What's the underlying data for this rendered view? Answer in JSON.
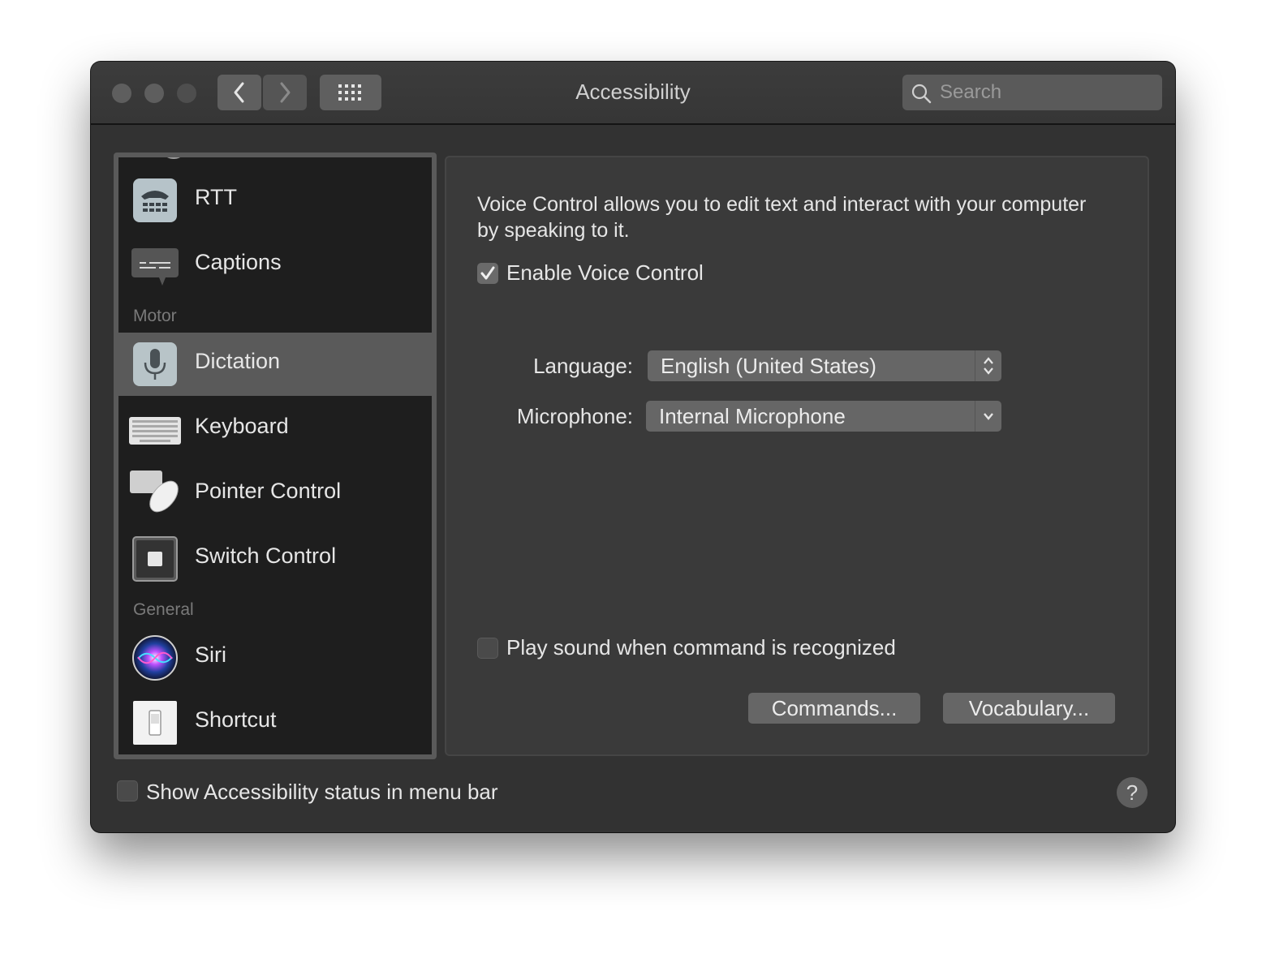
{
  "window": {
    "title": "Accessibility"
  },
  "toolbar": {
    "back_icon": "chevron-left-icon",
    "forward_icon": "chevron-right-icon",
    "grid_icon": "grid-icon",
    "search_placeholder": "Search"
  },
  "sidebar": {
    "sections": {
      "motor": "Motor",
      "general": "General"
    },
    "items": [
      {
        "label": "RTT",
        "icon": "rtt-icon"
      },
      {
        "label": "Captions",
        "icon": "captions-icon"
      },
      {
        "label": "Dictation",
        "icon": "microphone-icon",
        "selected": true
      },
      {
        "label": "Keyboard",
        "icon": "keyboard-icon"
      },
      {
        "label": "Pointer Control",
        "icon": "pointer-control-icon"
      },
      {
        "label": "Switch Control",
        "icon": "switch-control-icon"
      },
      {
        "label": "Siri",
        "icon": "siri-icon"
      },
      {
        "label": "Shortcut",
        "icon": "shortcut-icon"
      }
    ]
  },
  "panel": {
    "description": "Voice Control allows you to edit text and interact with your computer by speaking to it.",
    "enable_voice_control": {
      "label": "Enable Voice Control",
      "checked": true
    },
    "language": {
      "label": "Language:",
      "value": "English (United States)"
    },
    "microphone": {
      "label": "Microphone:",
      "value": "Internal Microphone"
    },
    "play_sound": {
      "label": "Play sound when command is recognized",
      "checked": false
    },
    "commands_button": "Commands...",
    "vocabulary_button": "Vocabulary..."
  },
  "footer": {
    "show_status": {
      "label": "Show Accessibility status in menu bar",
      "checked": false
    },
    "help_label": "?"
  }
}
